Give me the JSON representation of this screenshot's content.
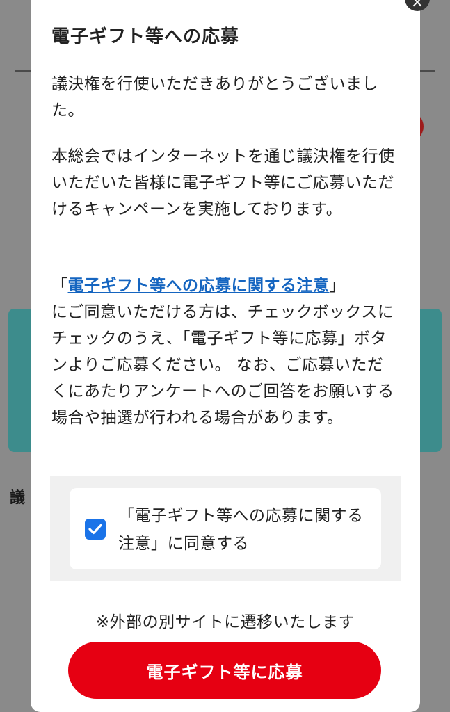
{
  "modal": {
    "title": "電子ギフト等への応募",
    "paragraph1": "議決権を行使いただきありがとうございました。",
    "paragraph2": "本総会ではインターネットを通じ議決権を行使いただいた皆様に電子ギフト等にご応募いただけるキャンペーンを実施しております。",
    "paragraph3_open_bracket": "「",
    "paragraph3_link": "電子ギフト等への応募に関する注意",
    "paragraph3_close_bracket": "」",
    "paragraph3_rest": "にご同意いただける方は、チェックボックスにチェックのうえ、「電子ギフト等に応募」ボタンよりご応募ください。 なお、ご応募いただくにあたりアンケートへのご回答をお願いする場合や抽選が行われる場合があります。",
    "consent_label": "「電子ギフト等への応募に関する注意」に同意する",
    "consent_checked": true,
    "note": "※外部の別サイトに遷移いたします",
    "submit_label": "電子ギフト等に応募",
    "close_icon": "×"
  },
  "background": {
    "label_fragment": "議"
  },
  "colors": {
    "accent": "#e60012",
    "link": "#1565c0",
    "checkbox": "#1a73e8"
  }
}
